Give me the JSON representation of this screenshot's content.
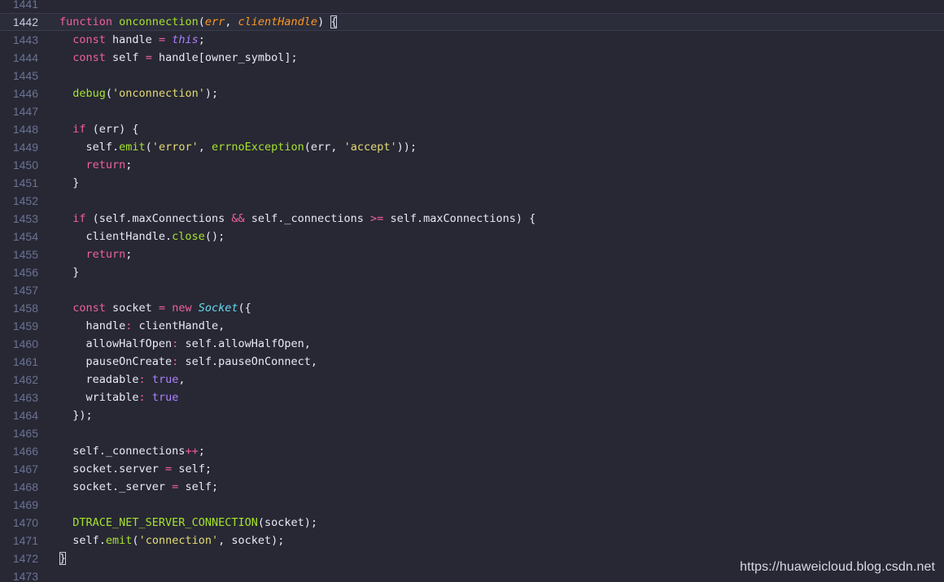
{
  "editor": {
    "current_line": "1442",
    "lines": [
      {
        "num": "1441",
        "tokens": []
      },
      {
        "num": "1442",
        "tokens": [
          {
            "t": "function",
            "c": "keyword"
          },
          {
            "t": " ",
            "c": "default"
          },
          {
            "t": "onconnection",
            "c": "fn"
          },
          {
            "t": "(",
            "c": "default"
          },
          {
            "t": "err",
            "c": "param"
          },
          {
            "t": ", ",
            "c": "default"
          },
          {
            "t": "clientHandle",
            "c": "param"
          },
          {
            "t": ") ",
            "c": "default"
          },
          {
            "t": "{",
            "c": "bracket-match"
          }
        ]
      },
      {
        "num": "1443",
        "tokens": [
          {
            "t": "  ",
            "c": "default"
          },
          {
            "t": "const",
            "c": "keyword"
          },
          {
            "t": " handle ",
            "c": "default"
          },
          {
            "t": "=",
            "c": "op"
          },
          {
            "t": " ",
            "c": "default"
          },
          {
            "t": "this",
            "c": "this"
          },
          {
            "t": ";",
            "c": "default"
          }
        ]
      },
      {
        "num": "1444",
        "tokens": [
          {
            "t": "  ",
            "c": "default"
          },
          {
            "t": "const",
            "c": "keyword"
          },
          {
            "t": " self ",
            "c": "default"
          },
          {
            "t": "=",
            "c": "op"
          },
          {
            "t": " handle[owner_symbol];",
            "c": "default"
          }
        ]
      },
      {
        "num": "1445",
        "tokens": []
      },
      {
        "num": "1446",
        "tokens": [
          {
            "t": "  ",
            "c": "default"
          },
          {
            "t": "debug",
            "c": "fn"
          },
          {
            "t": "(",
            "c": "default"
          },
          {
            "t": "'onconnection'",
            "c": "string"
          },
          {
            "t": ");",
            "c": "default"
          }
        ]
      },
      {
        "num": "1447",
        "tokens": []
      },
      {
        "num": "1448",
        "tokens": [
          {
            "t": "  ",
            "c": "default"
          },
          {
            "t": "if",
            "c": "keyword"
          },
          {
            "t": " (err) {",
            "c": "default"
          }
        ]
      },
      {
        "num": "1449",
        "tokens": [
          {
            "t": "    self.",
            "c": "default"
          },
          {
            "t": "emit",
            "c": "fn"
          },
          {
            "t": "(",
            "c": "default"
          },
          {
            "t": "'error'",
            "c": "string"
          },
          {
            "t": ", ",
            "c": "default"
          },
          {
            "t": "errnoException",
            "c": "fn"
          },
          {
            "t": "(err, ",
            "c": "default"
          },
          {
            "t": "'accept'",
            "c": "string"
          },
          {
            "t": "));",
            "c": "default"
          }
        ]
      },
      {
        "num": "1450",
        "tokens": [
          {
            "t": "    ",
            "c": "default"
          },
          {
            "t": "return",
            "c": "keyword"
          },
          {
            "t": ";",
            "c": "default"
          }
        ]
      },
      {
        "num": "1451",
        "tokens": [
          {
            "t": "  }",
            "c": "default"
          }
        ]
      },
      {
        "num": "1452",
        "tokens": []
      },
      {
        "num": "1453",
        "tokens": [
          {
            "t": "  ",
            "c": "default"
          },
          {
            "t": "if",
            "c": "keyword"
          },
          {
            "t": " (self.maxConnections ",
            "c": "default"
          },
          {
            "t": "&&",
            "c": "op"
          },
          {
            "t": " self._connections ",
            "c": "default"
          },
          {
            "t": ">=",
            "c": "op"
          },
          {
            "t": " self.maxConnections) {",
            "c": "default"
          }
        ]
      },
      {
        "num": "1454",
        "tokens": [
          {
            "t": "    clientHandle.",
            "c": "default"
          },
          {
            "t": "close",
            "c": "fn"
          },
          {
            "t": "();",
            "c": "default"
          }
        ]
      },
      {
        "num": "1455",
        "tokens": [
          {
            "t": "    ",
            "c": "default"
          },
          {
            "t": "return",
            "c": "keyword"
          },
          {
            "t": ";",
            "c": "default"
          }
        ]
      },
      {
        "num": "1456",
        "tokens": [
          {
            "t": "  }",
            "c": "default"
          }
        ]
      },
      {
        "num": "1457",
        "tokens": []
      },
      {
        "num": "1458",
        "tokens": [
          {
            "t": "  ",
            "c": "default"
          },
          {
            "t": "const",
            "c": "keyword"
          },
          {
            "t": " socket ",
            "c": "default"
          },
          {
            "t": "=",
            "c": "op"
          },
          {
            "t": " ",
            "c": "default"
          },
          {
            "t": "new",
            "c": "keyword"
          },
          {
            "t": " ",
            "c": "default"
          },
          {
            "t": "Socket",
            "c": "class"
          },
          {
            "t": "({",
            "c": "default"
          }
        ]
      },
      {
        "num": "1459",
        "tokens": [
          {
            "t": "    handle",
            "c": "key"
          },
          {
            "t": ":",
            "c": "colon"
          },
          {
            "t": " clientHandle,",
            "c": "default"
          }
        ]
      },
      {
        "num": "1460",
        "tokens": [
          {
            "t": "    allowHalfOpen",
            "c": "key"
          },
          {
            "t": ":",
            "c": "colon"
          },
          {
            "t": " self.allowHalfOpen,",
            "c": "default"
          }
        ]
      },
      {
        "num": "1461",
        "tokens": [
          {
            "t": "    pauseOnCreate",
            "c": "key"
          },
          {
            "t": ":",
            "c": "colon"
          },
          {
            "t": " self.pauseOnConnect,",
            "c": "default"
          }
        ]
      },
      {
        "num": "1462",
        "tokens": [
          {
            "t": "    readable",
            "c": "key"
          },
          {
            "t": ":",
            "c": "colon"
          },
          {
            "t": " ",
            "c": "default"
          },
          {
            "t": "true",
            "c": "bool"
          },
          {
            "t": ",",
            "c": "default"
          }
        ]
      },
      {
        "num": "1463",
        "tokens": [
          {
            "t": "    writable",
            "c": "key"
          },
          {
            "t": ":",
            "c": "colon"
          },
          {
            "t": " ",
            "c": "default"
          },
          {
            "t": "true",
            "c": "bool"
          }
        ]
      },
      {
        "num": "1464",
        "tokens": [
          {
            "t": "  });",
            "c": "default"
          }
        ]
      },
      {
        "num": "1465",
        "tokens": []
      },
      {
        "num": "1466",
        "tokens": [
          {
            "t": "  self._connections",
            "c": "default"
          },
          {
            "t": "++",
            "c": "op"
          },
          {
            "t": ";",
            "c": "default"
          }
        ]
      },
      {
        "num": "1467",
        "tokens": [
          {
            "t": "  socket.server ",
            "c": "default"
          },
          {
            "t": "=",
            "c": "op"
          },
          {
            "t": " self;",
            "c": "default"
          }
        ]
      },
      {
        "num": "1468",
        "tokens": [
          {
            "t": "  socket._server ",
            "c": "default"
          },
          {
            "t": "=",
            "c": "op"
          },
          {
            "t": " self;",
            "c": "default"
          }
        ]
      },
      {
        "num": "1469",
        "tokens": []
      },
      {
        "num": "1470",
        "tokens": [
          {
            "t": "  ",
            "c": "default"
          },
          {
            "t": "DTRACE_NET_SERVER_CONNECTION",
            "c": "fn"
          },
          {
            "t": "(socket);",
            "c": "default"
          }
        ]
      },
      {
        "num": "1471",
        "tokens": [
          {
            "t": "  self.",
            "c": "default"
          },
          {
            "t": "emit",
            "c": "fn"
          },
          {
            "t": "(",
            "c": "default"
          },
          {
            "t": "'connection'",
            "c": "string"
          },
          {
            "t": ", socket);",
            "c": "default"
          }
        ]
      },
      {
        "num": "1472",
        "tokens": [
          {
            "t": "}",
            "c": "bracket-match"
          }
        ]
      },
      {
        "num": "1473",
        "tokens": []
      }
    ]
  },
  "watermark": "https://huaweicloud.blog.csdn.net",
  "colors": {
    "background": "#272834",
    "keyword": "#f25f9e",
    "function": "#a6e22e",
    "string": "#e6db74",
    "parameter": "#fd971f",
    "class": "#66d9ef",
    "constant": "#ae81ff",
    "line_number": "#6b7394"
  }
}
